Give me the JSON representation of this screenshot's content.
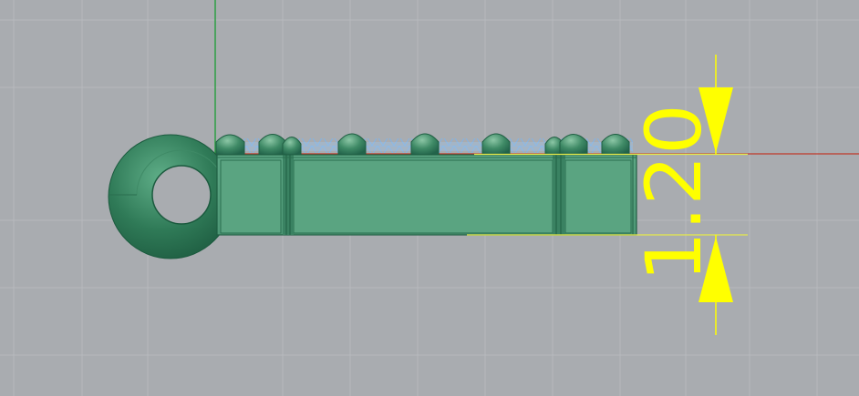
{
  "viewport": {
    "colors": {
      "background": "#a9acb0",
      "grid_minor": "#b6b9bd",
      "axis_x": "#c0392b",
      "axis_y": "#2e9e44",
      "model_fill": "#4f9a78",
      "model_dark": "#2a6e4f",
      "model_edge": "#1f5e42",
      "support_mesh": "#7eb3ea",
      "dimension": "#ffff00"
    }
  },
  "dimension": {
    "label": "1.20",
    "orientation": "vertical"
  }
}
